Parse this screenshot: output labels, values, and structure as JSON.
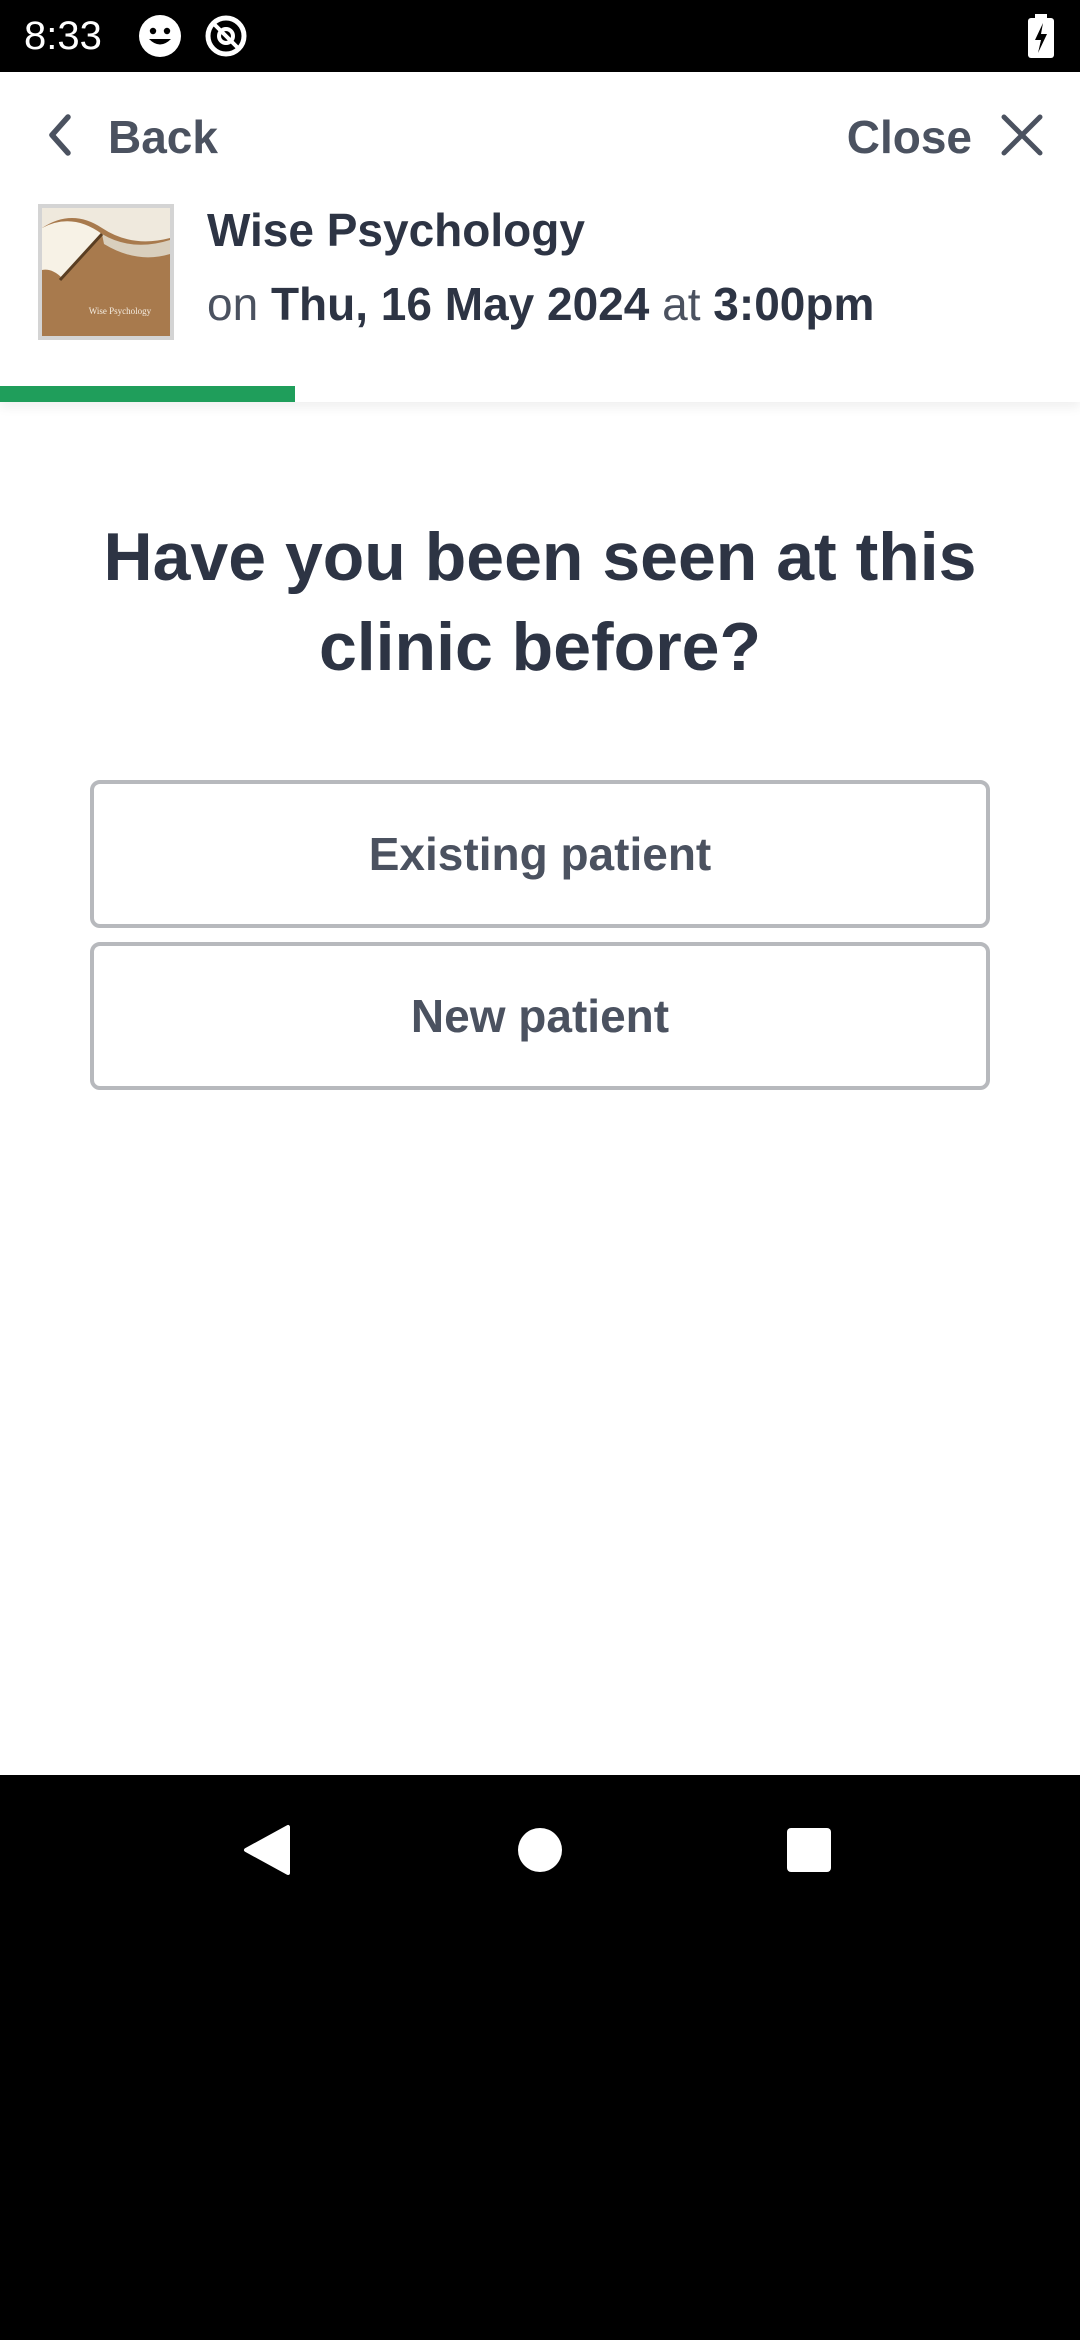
{
  "status_bar": {
    "time": "8:33",
    "icons": [
      "face-icon",
      "at-sign-icon",
      "battery-charging-icon"
    ]
  },
  "header": {
    "back_label": "Back",
    "close_label": "Close",
    "clinic_name": "Wise Psychology",
    "logo_text": "Wise Psychology",
    "appointment": {
      "prefix": "on",
      "date": "Thu, 16 May 2024",
      "connector": "at",
      "time": "3:00pm"
    },
    "progress_fraction": 0.273
  },
  "main": {
    "question": "Have you been seen at this clinic before?",
    "options": [
      {
        "label": "Existing patient"
      },
      {
        "label": "New patient"
      }
    ]
  },
  "colors": {
    "accent_green": "#1f9e5b",
    "text_dark": "#2d3444",
    "text_muted": "#4b5260",
    "option_border": "#b7b9bd"
  },
  "nav_bar": {
    "buttons": [
      "back-triangle-icon",
      "home-circle-icon",
      "recents-square-icon"
    ]
  }
}
